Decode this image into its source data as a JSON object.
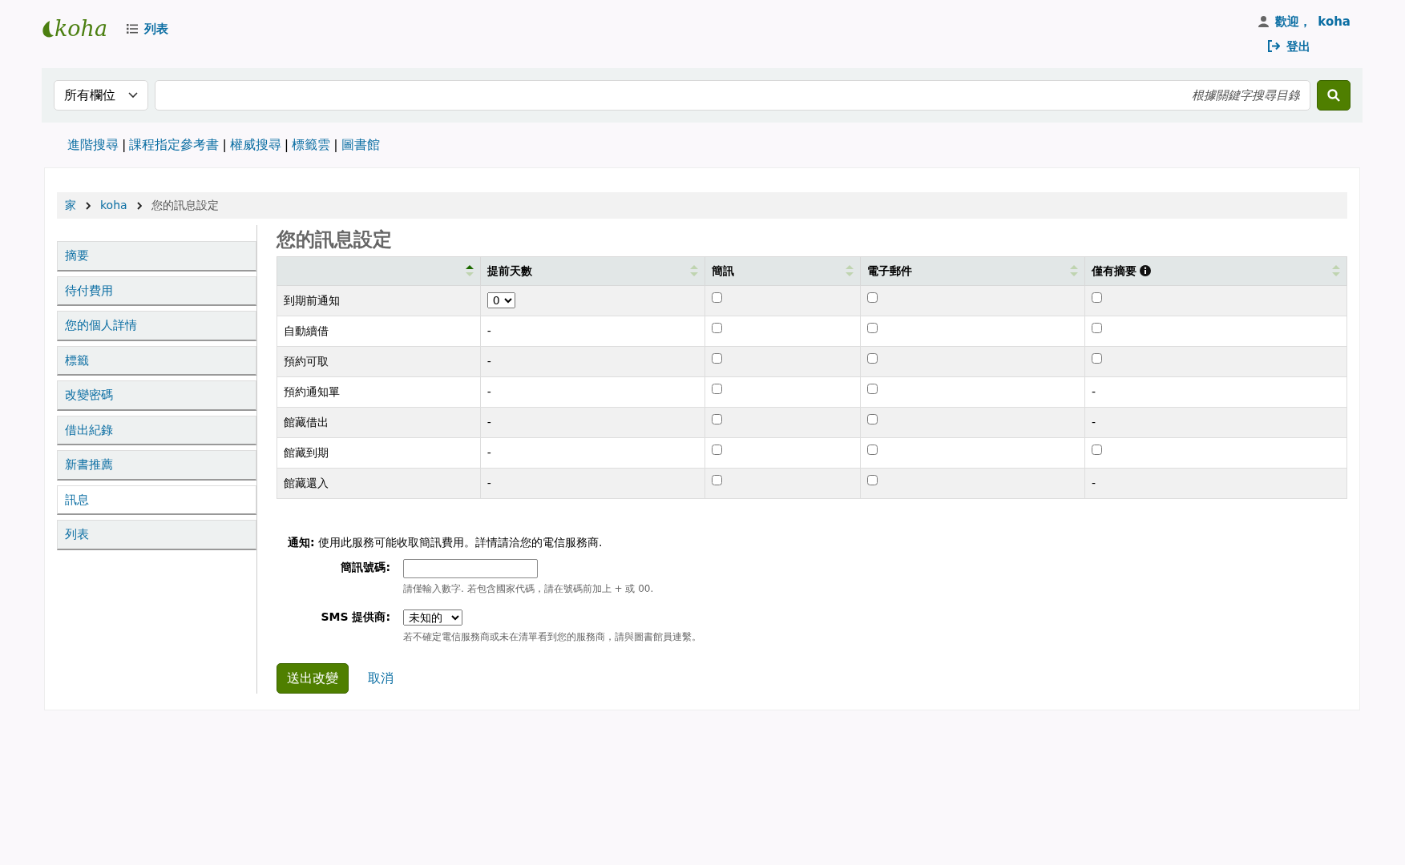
{
  "header": {
    "logo": "koha",
    "lists_link": "列表",
    "welcome_label": "歡迎，",
    "username": "koha",
    "logout": "登出"
  },
  "search": {
    "scope": "所有欄位",
    "placeholder": "根據關鍵字搜尋目錄"
  },
  "nav_links": [
    {
      "kind": "link",
      "text": "進階搜尋"
    },
    {
      "kind": "separator",
      "text": "|"
    },
    {
      "kind": "link",
      "text": "課程指定參考書"
    },
    {
      "kind": "separator",
      "text": "|"
    },
    {
      "kind": "link",
      "text": "權威搜尋"
    },
    {
      "kind": "separator",
      "text": "|"
    },
    {
      "kind": "link",
      "text": "標籤雲"
    },
    {
      "kind": "separator",
      "text": "|"
    },
    {
      "kind": "link",
      "text": "圖書館"
    }
  ],
  "breadcrumbs": [
    {
      "text": "家",
      "link": true
    },
    {
      "text": "koha",
      "link": true
    },
    {
      "text": "您的訊息設定",
      "link": false
    }
  ],
  "sidebar": {
    "items": [
      {
        "label": "摘要",
        "selected": false
      },
      {
        "label": "待付費用",
        "selected": false
      },
      {
        "label": "您的個人詳情",
        "selected": false
      },
      {
        "label": "標籤",
        "selected": false
      },
      {
        "label": "改變密碼",
        "selected": false
      },
      {
        "label": "借出紀錄",
        "selected": false
      },
      {
        "label": "新書推薦",
        "selected": false
      },
      {
        "label": "訊息",
        "selected": true
      },
      {
        "label": "列表",
        "selected": false
      }
    ]
  },
  "page_title": "您的訊息設定",
  "table": {
    "columns": [
      {
        "sorted": true,
        "info": false
      },
      {
        "label": "提前天數",
        "sorted": false,
        "info": false
      },
      {
        "label": "簡訊",
        "sorted": false,
        "info": false
      },
      {
        "label": "電子郵件",
        "sorted": false,
        "info": false
      },
      {
        "label": "僅有摘要",
        "sorted": false,
        "info": true
      }
    ],
    "rows": [
      {
        "name": "到期前通知",
        "cells": [
          {
            "kind": "select",
            "value": "0"
          },
          {
            "kind": "checkbox",
            "checked": false
          },
          {
            "kind": "checkbox",
            "checked": false
          },
          {
            "kind": "checkbox",
            "checked": false
          }
        ]
      },
      {
        "name": "自動續借",
        "cells": [
          {
            "kind": "dash",
            "text": "-"
          },
          {
            "kind": "checkbox",
            "checked": false
          },
          {
            "kind": "checkbox",
            "checked": false
          },
          {
            "kind": "checkbox",
            "checked": false
          }
        ]
      },
      {
        "name": "預約可取",
        "cells": [
          {
            "kind": "dash",
            "text": "-"
          },
          {
            "kind": "checkbox",
            "checked": false
          },
          {
            "kind": "checkbox",
            "checked": false
          },
          {
            "kind": "checkbox",
            "checked": false
          }
        ]
      },
      {
        "name": "預約通知單",
        "cells": [
          {
            "kind": "dash",
            "text": "-"
          },
          {
            "kind": "checkbox",
            "checked": false
          },
          {
            "kind": "checkbox",
            "checked": false
          },
          {
            "kind": "dash",
            "text": "-"
          }
        ]
      },
      {
        "name": "館藏借出",
        "cells": [
          {
            "kind": "dash",
            "text": "-"
          },
          {
            "kind": "checkbox",
            "checked": false
          },
          {
            "kind": "checkbox",
            "checked": false
          },
          {
            "kind": "dash",
            "text": "-"
          }
        ]
      },
      {
        "name": "館藏到期",
        "cells": [
          {
            "kind": "dash",
            "text": "-"
          },
          {
            "kind": "checkbox",
            "checked": false
          },
          {
            "kind": "checkbox",
            "checked": false
          },
          {
            "kind": "checkbox",
            "checked": false
          }
        ]
      },
      {
        "name": "館藏還入",
        "cells": [
          {
            "kind": "dash",
            "text": "-"
          },
          {
            "kind": "checkbox",
            "checked": false
          },
          {
            "kind": "checkbox",
            "checked": false
          },
          {
            "kind": "dash",
            "text": "-"
          }
        ]
      }
    ]
  },
  "notice": "**通知:** 使用此服務可能收取簡訊費用。詳情請洽您的電信服務商.",
  "fields": [
    {
      "kind": "text",
      "label": "簡訊號碼:",
      "hint": "請僅輸入數字. 若包含國家代碼，請在號碼前加上 + 或 00."
    },
    {
      "kind": "select",
      "label": "SMS 提供商:",
      "value": "未知的",
      "hint": "若不確定電信服務商或未在清單看到您的服務商，請與圖書館員連繫。"
    }
  ],
  "buttons": {
    "submit": "送出改變",
    "cancel": "取消"
  }
}
